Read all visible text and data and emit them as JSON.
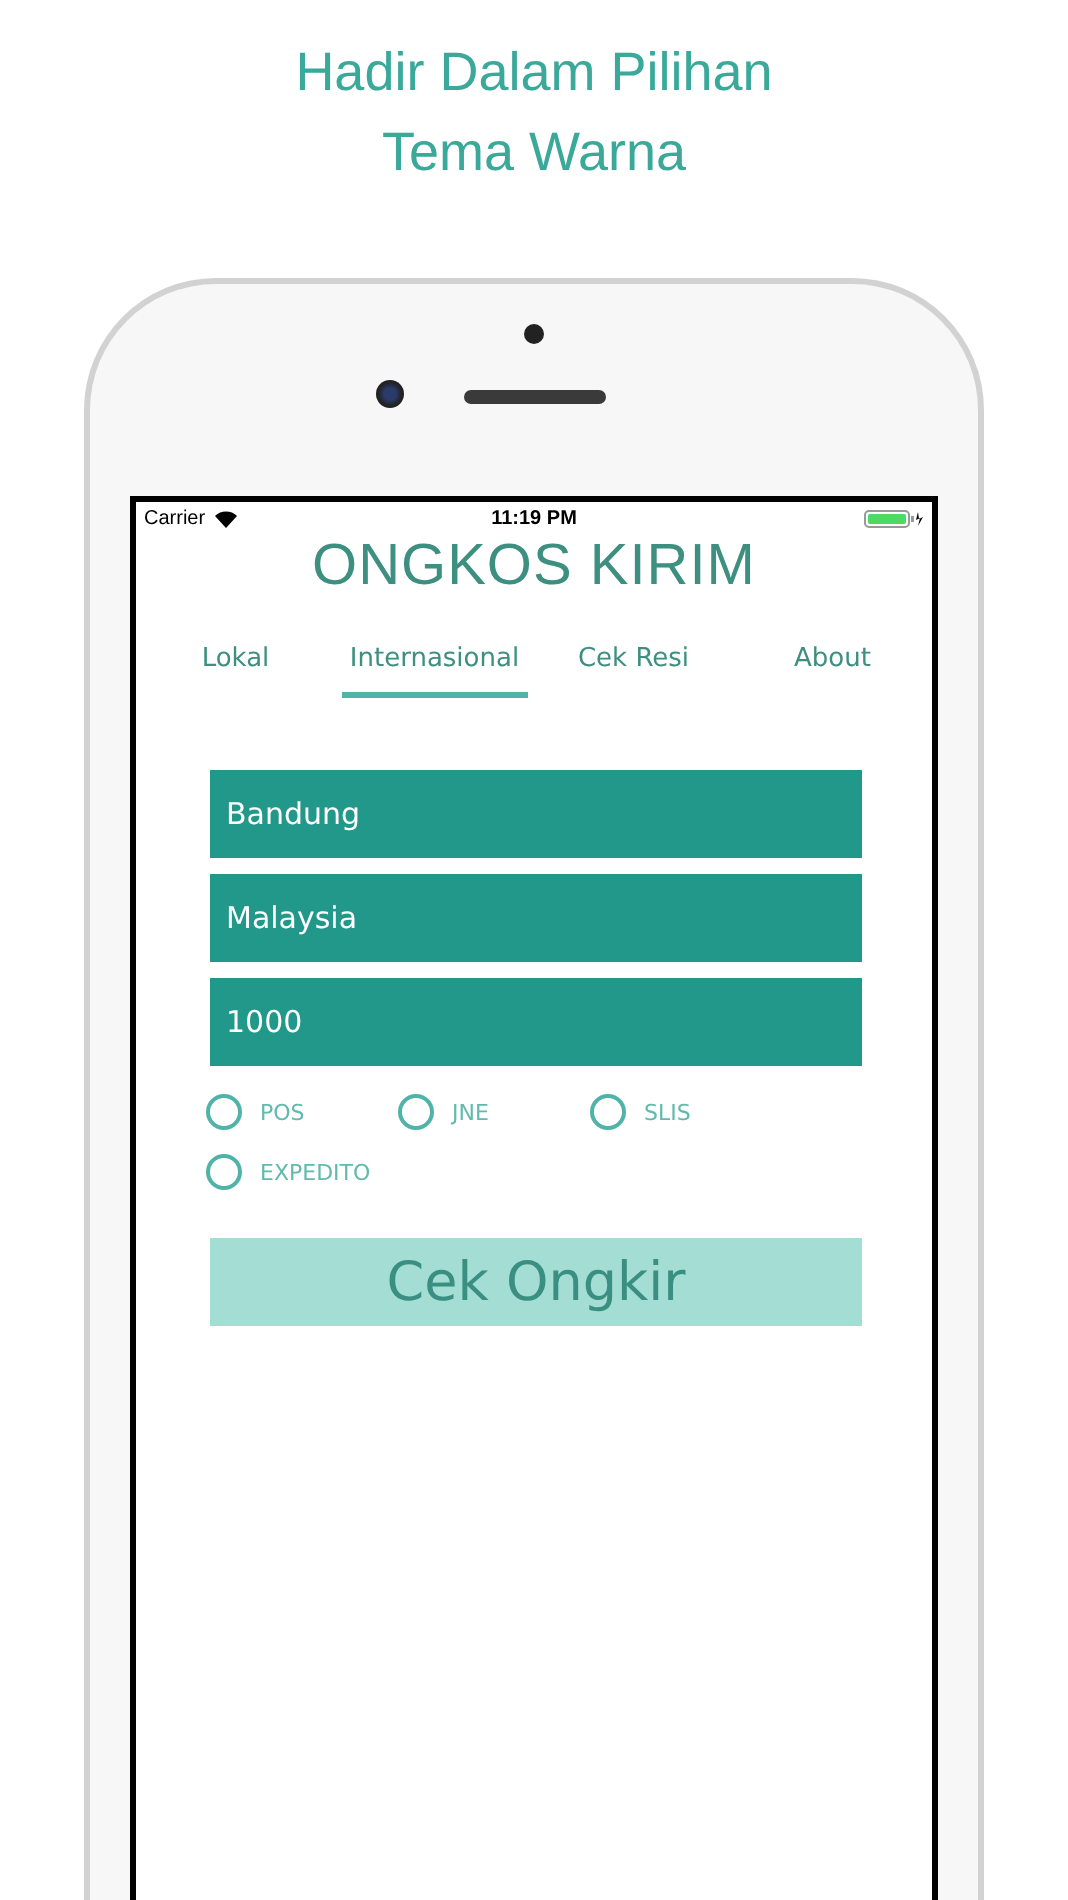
{
  "headline": [
    "Hadir Dalam Pilihan",
    "Tema Warna"
  ],
  "status_bar": {
    "carrier": "Carrier",
    "time": "11:19 PM"
  },
  "app_title": "ONGKOS KIRIM",
  "tabs": [
    {
      "label": "Lokal",
      "selected": false
    },
    {
      "label": "Internasional",
      "selected": true
    },
    {
      "label": "Cek Resi",
      "selected": false
    },
    {
      "label": "About",
      "selected": false
    }
  ],
  "fields": [
    {
      "value": "Bandung"
    },
    {
      "value": "Malaysia"
    },
    {
      "value": "1000"
    }
  ],
  "couriers": [
    {
      "label": "POS",
      "selected": false
    },
    {
      "label": "JNE",
      "selected": false
    },
    {
      "label": "SLIS",
      "selected": false
    },
    {
      "label": "EXPEDITO",
      "selected": false
    }
  ],
  "button": "Cek Ongkir"
}
